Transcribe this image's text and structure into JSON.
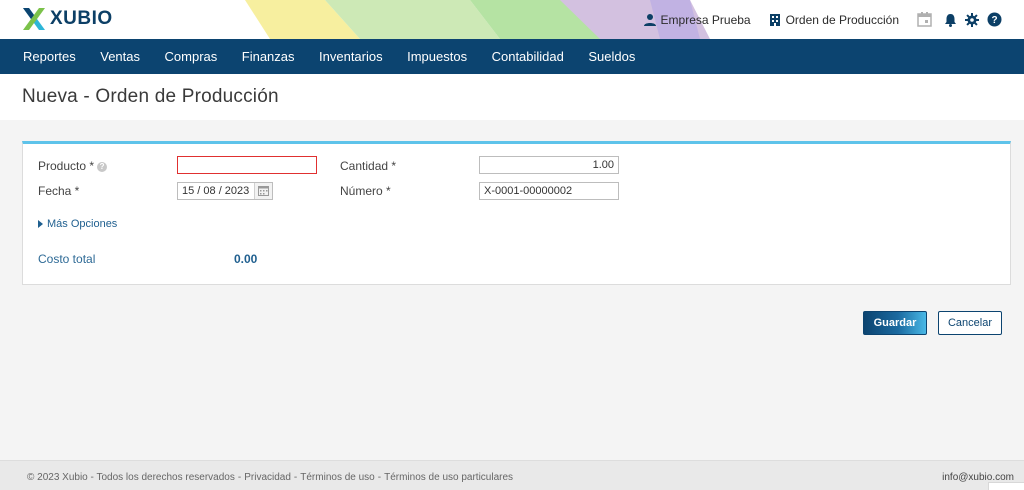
{
  "brand": {
    "name": "XUBIO"
  },
  "header": {
    "company": "Empresa Prueba",
    "module": "Orden de Producción"
  },
  "nav": {
    "items": [
      "Reportes",
      "Ventas",
      "Compras",
      "Finanzas",
      "Inventarios",
      "Impuestos",
      "Contabilidad",
      "Sueldos"
    ]
  },
  "page": {
    "title": "Nueva - Orden de Producción"
  },
  "form": {
    "producto_label": "Producto *",
    "producto_value": "",
    "fecha_label": "Fecha *",
    "fecha_value": "15 / 08 /  2023",
    "cantidad_label": "Cantidad *",
    "cantidad_value": "1.00",
    "numero_label": "Número *",
    "numero_value": "X-0001-00000002",
    "mas_opciones": "Más Opciones",
    "costo_label": "Costo total",
    "costo_value": "0.00"
  },
  "actions": {
    "save": "Guardar",
    "cancel": "Cancelar"
  },
  "footer": {
    "copyright": "© 2023 Xubio - Todos los derechos reservados",
    "privacy": "Privacidad",
    "terms": "Términos de uso",
    "terms_particular": "Términos de uso particulares",
    "email": "info@xubio.com"
  },
  "colors": {
    "navy": "#0c4470",
    "accent": "#5ec3ea",
    "error": "#e03030"
  },
  "icons": [
    "user-icon",
    "building-icon",
    "calendar-icon",
    "bell-icon",
    "gear-icon",
    "help-icon",
    "question-icon",
    "caret-right-icon"
  ]
}
